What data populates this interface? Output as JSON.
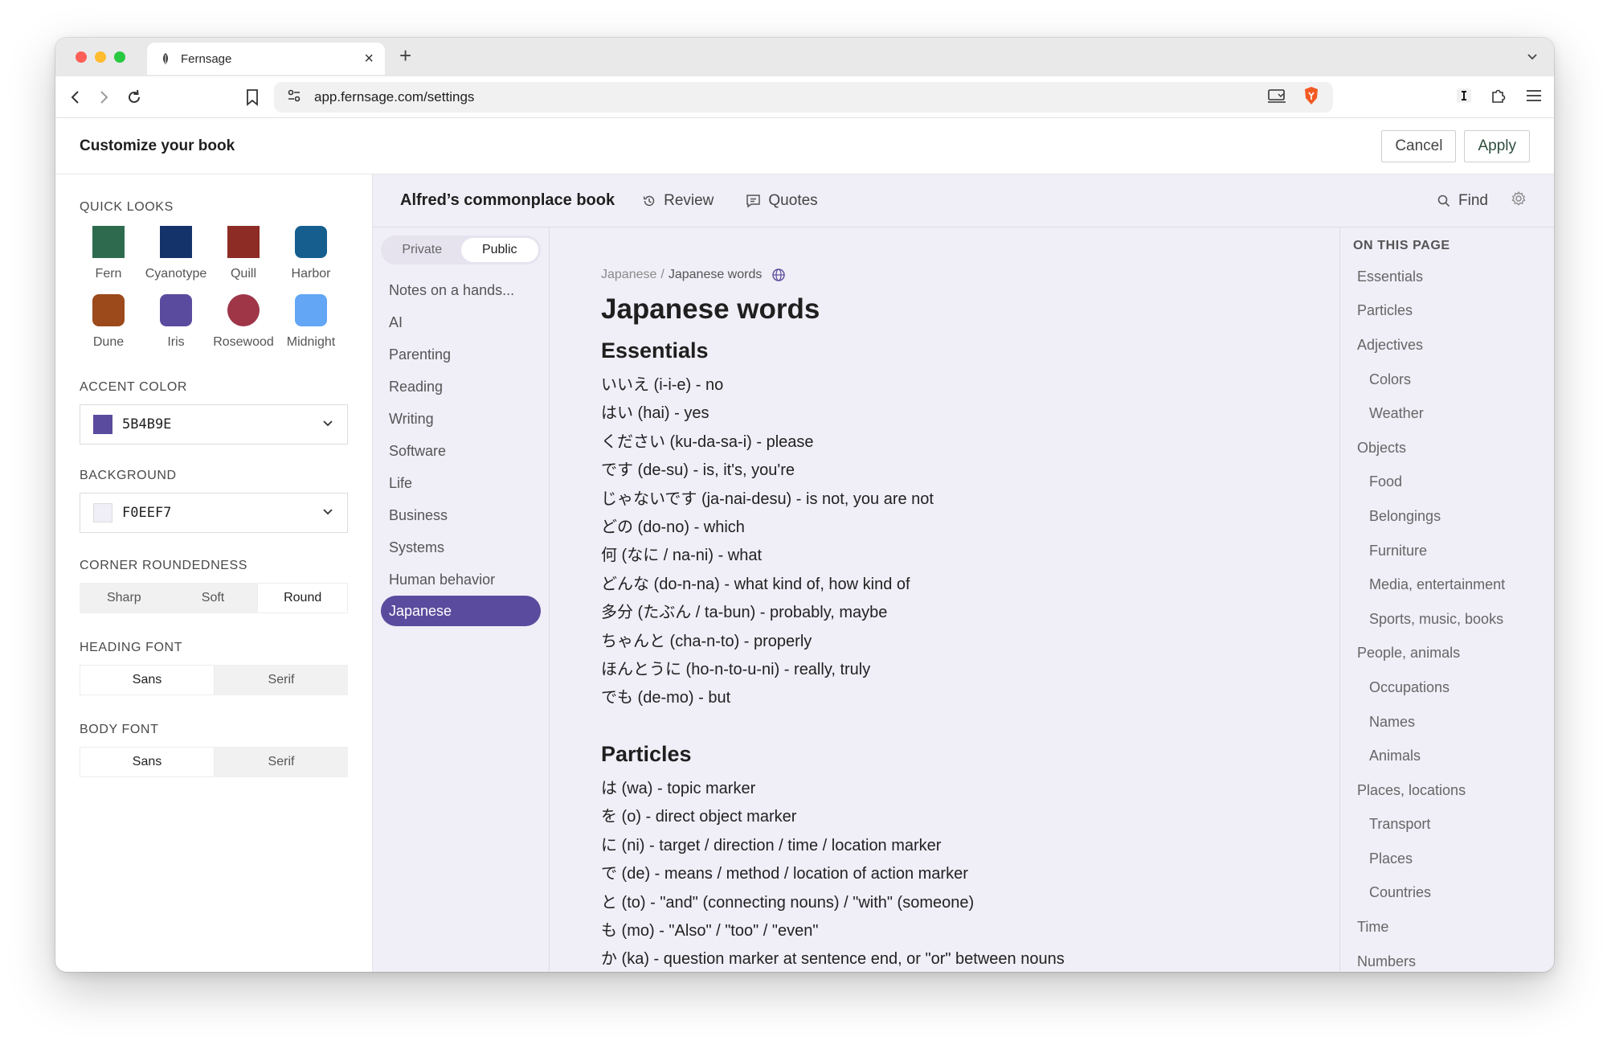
{
  "browser": {
    "tab_title": "Fernsage",
    "url": "app.fernsage.com/settings"
  },
  "header": {
    "title": "Customize your book",
    "cancel_label": "Cancel",
    "apply_label": "Apply"
  },
  "settings": {
    "quick_looks_label": "QUICK LOOKS",
    "looks": [
      {
        "name": "Fern",
        "color": "#2e6b4e",
        "radius": "sharp"
      },
      {
        "name": "Cyanotype",
        "color": "#15336b",
        "radius": "sharp"
      },
      {
        "name": "Quill",
        "color": "#8c2c25",
        "radius": "sharp"
      },
      {
        "name": "Harbor",
        "color": "#155e8e",
        "radius": "soft"
      },
      {
        "name": "Dune",
        "color": "#9c4a1c",
        "radius": "soft"
      },
      {
        "name": "Iris",
        "color": "#5b4b9e",
        "radius": "soft"
      },
      {
        "name": "Rosewood",
        "color": "#9e3648",
        "radius": "round"
      },
      {
        "name": "Midnight",
        "color": "#62a6f5",
        "radius": "soft"
      }
    ],
    "accent_label": "ACCENT COLOR",
    "accent_value": "5B4B9E",
    "accent_color": "#5b4b9e",
    "background_label": "BACKGROUND",
    "background_value": "F0EEF7",
    "background_color": "#f0eef7",
    "corner_label": "CORNER ROUNDEDNESS",
    "corner_options": [
      "Sharp",
      "Soft",
      "Round"
    ],
    "corner_selected": "Round",
    "heading_font_label": "HEADING FONT",
    "heading_font_options": [
      "Sans",
      "Serif"
    ],
    "heading_font_selected": "Sans",
    "body_font_label": "BODY FONT",
    "body_font_options": [
      "Sans",
      "Serif"
    ],
    "body_font_selected": "Sans"
  },
  "preview": {
    "book_title": "Alfred’s commonplace book",
    "review_label": "Review",
    "quotes_label": "Quotes",
    "find_label": "Find",
    "visibility": {
      "private": "Private",
      "public": "Public",
      "selected": "Public"
    },
    "nav_items": [
      "Notes on a hands...",
      "AI",
      "Parenting",
      "Reading",
      "Writing",
      "Software",
      "Life",
      "Business",
      "Systems",
      "Human behavior",
      "Japanese"
    ],
    "nav_selected": "Japanese",
    "breadcrumb_parent": "Japanese",
    "breadcrumb_current": "Japanese words",
    "page_title": "Japanese words",
    "sections": [
      {
        "heading": "Essentials",
        "entries": [
          "いいえ (i-i-e) - no",
          "はい (hai) - yes",
          "ください (ku-da-sa-i) - please",
          "です (de-su) - is, it's, you're",
          "じゃないです (ja-nai-desu) - is not, you are not",
          "どの (do-no) - which",
          "何 (なに / na-ni) - what",
          "どんな (do-n-na) - what kind of, how kind of",
          "多分 (たぶん / ta-bun) - probably, maybe",
          "ちゃんと (cha-n-to) - properly",
          "ほんとうに (ho-n-to-u-ni) - really, truly",
          "でも (de-mo) - but"
        ]
      },
      {
        "heading": "Particles",
        "entries": [
          "は (wa) - topic marker",
          "を (o) - direct object marker",
          "に (ni) - target / direction / time / location marker",
          "で (de) - means / method / location of action marker",
          "と (to) - \"and\" (connecting nouns) / \"with\" (someone)",
          "も (mo) - \"Also\" / \"too\" / \"even\"",
          "か (ka) - question marker at sentence end, or \"or\" between nouns"
        ]
      }
    ],
    "toc_title": "ON THIS PAGE",
    "toc": [
      {
        "label": "Essentials",
        "level": 1
      },
      {
        "label": "Particles",
        "level": 1
      },
      {
        "label": "Adjectives",
        "level": 1
      },
      {
        "label": "Colors",
        "level": 2
      },
      {
        "label": "Weather",
        "level": 2
      },
      {
        "label": "Objects",
        "level": 1
      },
      {
        "label": "Food",
        "level": 2
      },
      {
        "label": "Belongings",
        "level": 2
      },
      {
        "label": "Furniture",
        "level": 2
      },
      {
        "label": "Media, entertainment",
        "level": 2
      },
      {
        "label": "Sports, music, books",
        "level": 2
      },
      {
        "label": "People, animals",
        "level": 1
      },
      {
        "label": "Occupations",
        "level": 2
      },
      {
        "label": "Names",
        "level": 2
      },
      {
        "label": "Animals",
        "level": 2
      },
      {
        "label": "Places, locations",
        "level": 1
      },
      {
        "label": "Transport",
        "level": 2
      },
      {
        "label": "Places",
        "level": 2
      },
      {
        "label": "Countries",
        "level": 2
      },
      {
        "label": "Time",
        "level": 1
      },
      {
        "label": "Numbers",
        "level": 1
      }
    ]
  },
  "icons": {
    "favicon": "fern-leaf-icon",
    "review": "history-icon",
    "quotes": "quote-bubble-icon",
    "find": "search-icon",
    "settings": "gear-icon",
    "globe": "globe-icon"
  }
}
